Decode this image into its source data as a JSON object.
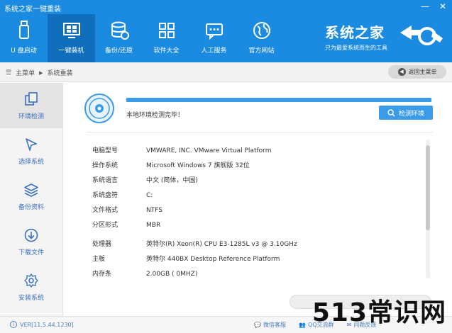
{
  "window": {
    "title": "系统之家一键重装",
    "minimize": "—",
    "close": "✕"
  },
  "nav": [
    {
      "label": "U 盘启动",
      "icon": "usb-icon"
    },
    {
      "label": "一键装机",
      "icon": "windows-icon"
    },
    {
      "label": "备份/还原",
      "icon": "database-icon"
    },
    {
      "label": "软件大全",
      "icon": "apps-icon"
    },
    {
      "label": "人工服务",
      "icon": "chat-icon"
    },
    {
      "label": "官方网站",
      "icon": "globe-icon"
    }
  ],
  "brand": {
    "title": "系统之家",
    "subtitle": "只为最爱系统而生的工具"
  },
  "breadcrumb": {
    "home": "主菜单",
    "current": "系统重装",
    "back": "返回主菜单"
  },
  "sidebar": [
    {
      "label": "环境检测",
      "icon": "copy-icon"
    },
    {
      "label": "选择系统",
      "icon": "cursor-icon"
    },
    {
      "label": "备份资料",
      "icon": "layers-icon"
    },
    {
      "label": "下载文件",
      "icon": "download-icon"
    },
    {
      "label": "安装系统",
      "icon": "settings-icon"
    }
  ],
  "main": {
    "status": "本地环境检测完毕！",
    "detect_button": "检测环境",
    "progress": 1.0,
    "info": [
      {
        "key": "电脑型号",
        "value": "VMWARE, INC. VMware Virtual Platform"
      },
      {
        "key": "操作系统",
        "value": "Microsoft Windows 7 旗舰版  32位"
      },
      {
        "key": "系统语言",
        "value": "中文 (简体，中国)"
      },
      {
        "key": "系统盘符",
        "value": "C:"
      },
      {
        "key": "文件格式",
        "value": "NTFS"
      },
      {
        "key": "分区形式",
        "value": "MBR"
      },
      {
        "key": "处理器",
        "value": "英特尔(R) Xeon(R) CPU E3-1285L v3 @ 3.10GHz"
      },
      {
        "key": "主板",
        "value": "英特尔 440BX Desktop Reference Platform"
      },
      {
        "key": "内存条",
        "value": "2.00GB ( 0MHZ)"
      }
    ]
  },
  "footer": {
    "version": "VER[11.5.44.1230]",
    "links": [
      "微信客服",
      "QQ交流群",
      "问题反馈"
    ]
  },
  "watermark": "513常识网"
}
